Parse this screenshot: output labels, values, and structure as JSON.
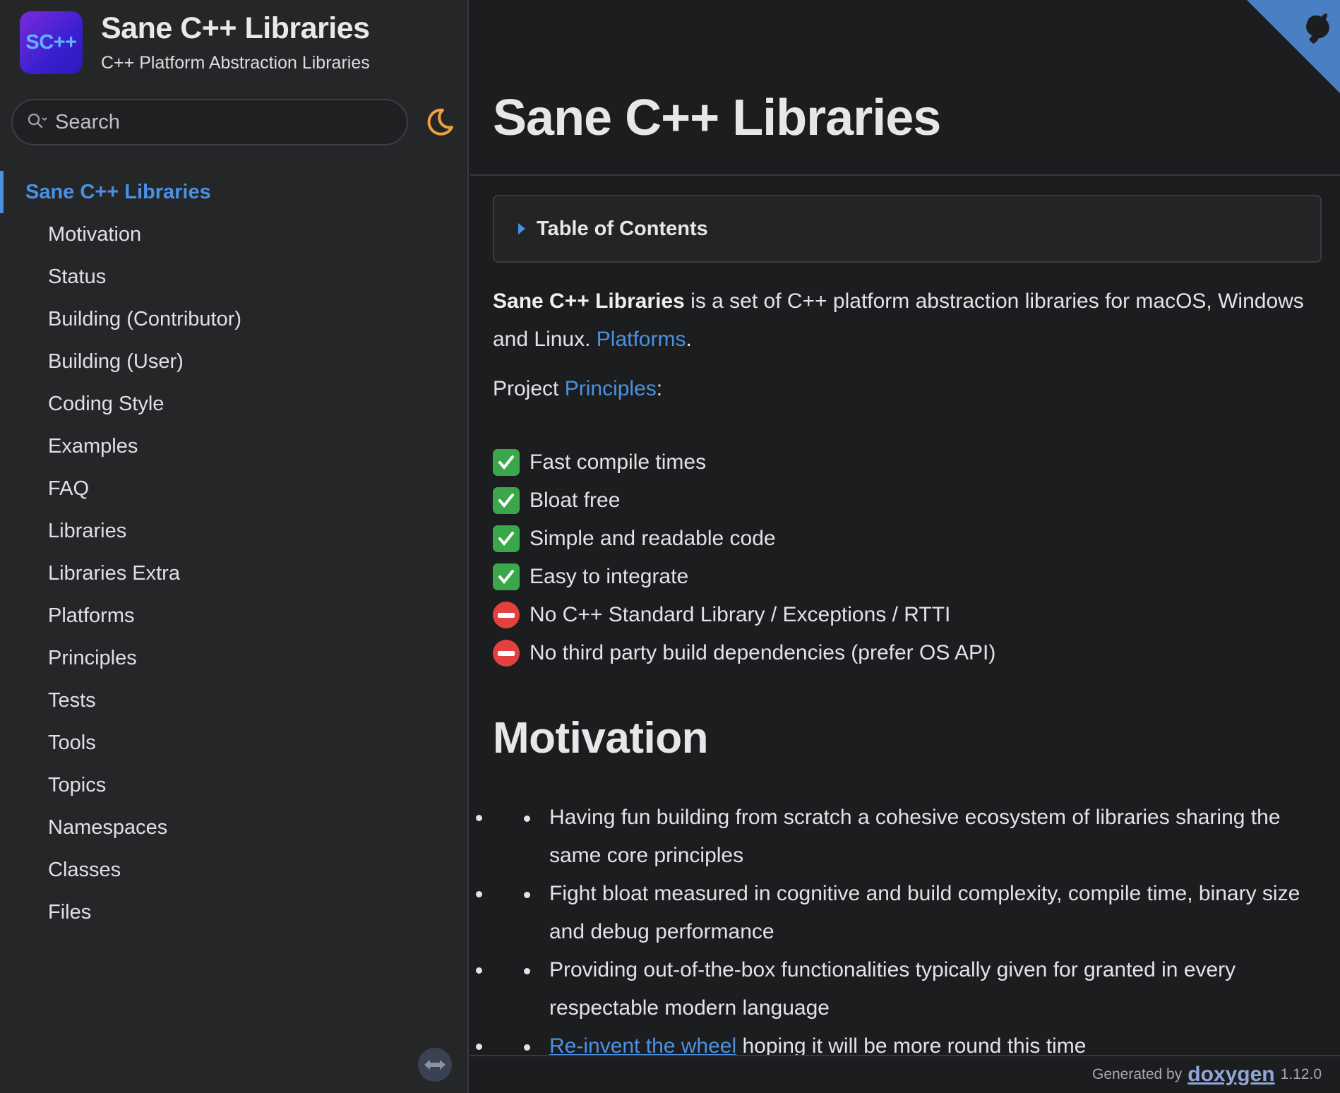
{
  "brand": {
    "logo_text": "SC++",
    "title": "Sane C++ Libraries",
    "subtitle": "C++ Platform Abstraction Libraries"
  },
  "search": {
    "placeholder": "Search"
  },
  "nav": {
    "active": "Sane C++ Libraries",
    "items": [
      "Motivation",
      "Status",
      "Building (Contributor)",
      "Building (User)",
      "Coding Style",
      "Examples",
      "FAQ",
      "Libraries",
      "Libraries Extra",
      "Platforms",
      "Principles",
      "Tests",
      "Tools",
      "Topics",
      "Namespaces",
      "Classes",
      "Files"
    ]
  },
  "main": {
    "title": "Sane C++ Libraries",
    "toc_label": "Table of Contents",
    "intro_bold": "Sane C++ Libraries",
    "intro_text": " is a set of C++ platform abstraction libraries for macOS, Windows and Linux. ",
    "intro_link": "Platforms",
    "intro_end": ".",
    "project_text": "Project ",
    "project_link": "Principles",
    "project_end": ":",
    "principles": [
      {
        "kind": "check",
        "text": "Fast compile times"
      },
      {
        "kind": "check",
        "text": "Bloat free"
      },
      {
        "kind": "check",
        "text": "Simple and readable code"
      },
      {
        "kind": "check",
        "text": "Easy to integrate"
      },
      {
        "kind": "no",
        "text": "No C++ Standard Library / Exceptions / RTTI"
      },
      {
        "kind": "no",
        "text": "No third party build dependencies (prefer OS API)"
      }
    ],
    "section_heading": "Motivation",
    "motivation": [
      "Having fun building from scratch a cohesive ecosystem of libraries sharing the same core principles",
      "Fight bloat measured in cognitive and build complexity, compile time, binary size and debug performance",
      "Providing out-of-the-box functionalities typically given for granted in every respectable modern language"
    ],
    "last_bullet_link": "Re-invent the wheel",
    "last_bullet_text": " hoping it will be more round this time"
  },
  "footer": {
    "generated_by": "Generated by",
    "tool": "doxygen",
    "version": "1.12.0"
  },
  "colors": {
    "accent": "#4b91e2",
    "sidebar_bg": "#252628",
    "main_bg": "#1c1d1f",
    "check": "#3aa84a",
    "no_entry": "#e54040",
    "corner": "#4a7fc4",
    "moon": "#f0a13a"
  }
}
